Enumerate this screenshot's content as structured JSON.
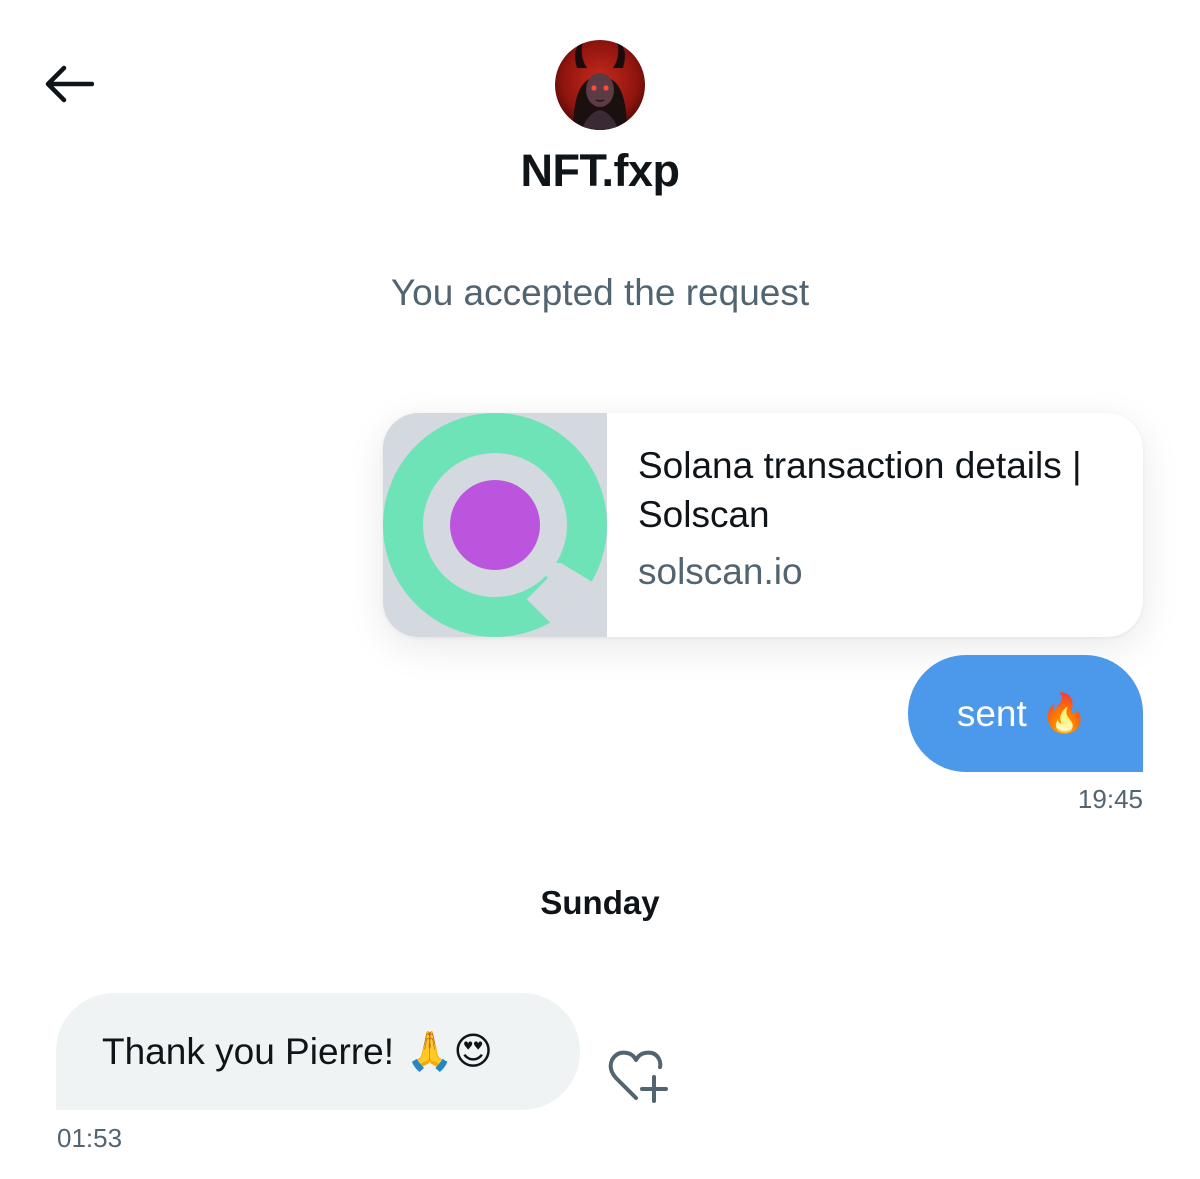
{
  "header": {
    "back_icon": "arrow-left-icon",
    "contact_name": "NFT.fxp",
    "avatar": "profile-avatar"
  },
  "conversation": {
    "system_message": "You accepted the request",
    "link_card": {
      "title": "Solana transaction details | Solscan",
      "domain": "solscan.io",
      "thumbnail_icon": "solscan-logo",
      "brand_colors": {
        "ring": "#6ee3b8",
        "dot": "#bb55dd",
        "background": "#d3d9df"
      }
    },
    "outgoing_message": {
      "text": "sent",
      "emoji": "🔥",
      "time": "19:45",
      "bubble_color": "#4c98ea"
    },
    "day_separator": "Sunday",
    "incoming_message": {
      "text": "Thank you Pierre!",
      "emoji": "🙏😍",
      "time": "01:53",
      "bubble_color": "#eff3f4",
      "react_icon": "heart-plus-icon"
    }
  },
  "colors": {
    "secondary_text": "#536471",
    "primary_text": "#0f1419"
  }
}
